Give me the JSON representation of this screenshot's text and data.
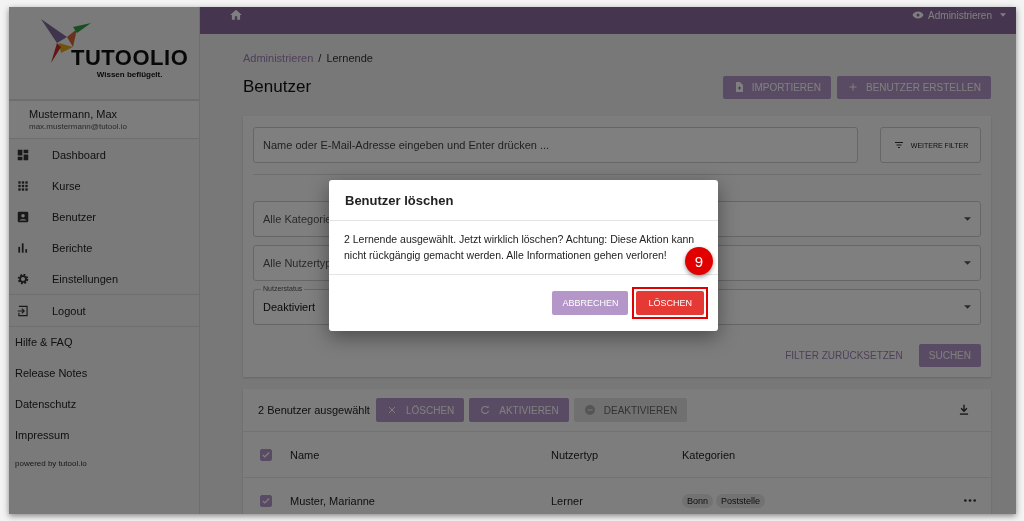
{
  "sidebar": {
    "logo": {
      "name": "TUTOOLIO",
      "tagline": "Wissen beflügelt."
    },
    "user": {
      "name": "Mustermann, Max",
      "email": "max.mustermann@tutool.io"
    },
    "nav": [
      {
        "label": "Dashboard",
        "kind": "dashboard"
      },
      {
        "label": "Kurse",
        "kind": "grid"
      },
      {
        "label": "Benutzer",
        "kind": "user"
      },
      {
        "label": "Berichte",
        "kind": "chart"
      },
      {
        "label": "Einstellungen",
        "kind": "gear"
      },
      {
        "label": "Logout",
        "kind": "logout"
      }
    ],
    "links": [
      "Hilfe & FAQ",
      "Release Notes",
      "Datenschutz",
      "Impressum"
    ],
    "footer": "powered by tutool.io"
  },
  "topbar": {
    "menu": "Administrieren"
  },
  "breadcrumb": {
    "parent": "Administrieren",
    "separator": "/",
    "current": "Lernende"
  },
  "title": "Benutzer",
  "header_buttons": [
    {
      "label": "IMPORTIEREN",
      "kind": "import"
    },
    {
      "label": "BENUTZER ERSTELLEN",
      "kind": "plus"
    }
  ],
  "filter": {
    "search_placeholder": "Name oder E-Mail-Adresse eingeben und Enter drücken ...",
    "more_filters": "WEITERE FILTER",
    "dropdowns": [
      {
        "value": "Alle Kategorie"
      },
      {
        "value": "Alle Nutzertyp"
      },
      {
        "legend": "Nutzerstatus",
        "value": "Deaktiviert"
      }
    ],
    "reset": "FILTER ZURÜCKSETZEN",
    "search": "SUCHEN"
  },
  "selection": {
    "count_label": "2 Benutzer ausgewählt",
    "actions": [
      {
        "label": "LÖSCHEN",
        "kind": "close",
        "disabled": false
      },
      {
        "label": "AKTIVIEREN",
        "kind": "refresh",
        "disabled": false
      },
      {
        "label": "DEAKTIVIEREN",
        "kind": "minus",
        "disabled": true
      }
    ]
  },
  "table": {
    "all_checked": true,
    "columns": [
      "Name",
      "Nutzertyp",
      "Kategorien"
    ],
    "rows": [
      {
        "name": "Muster, Marianne",
        "type": "Lerner",
        "tags": [
          "Bonn",
          "Poststelle"
        ],
        "checked": true
      }
    ]
  },
  "dialog": {
    "title": "Benutzer löschen",
    "text": "2 Lernende ausgewählt. Jetzt wirklich löschen? Achtung: Diese Aktion kann nicht rückgängig gemacht werden. Alle Informationen gehen verloren!",
    "cancel": "ABBRECHEN",
    "confirm": "LÖSCHEN",
    "step_badge": "9"
  }
}
